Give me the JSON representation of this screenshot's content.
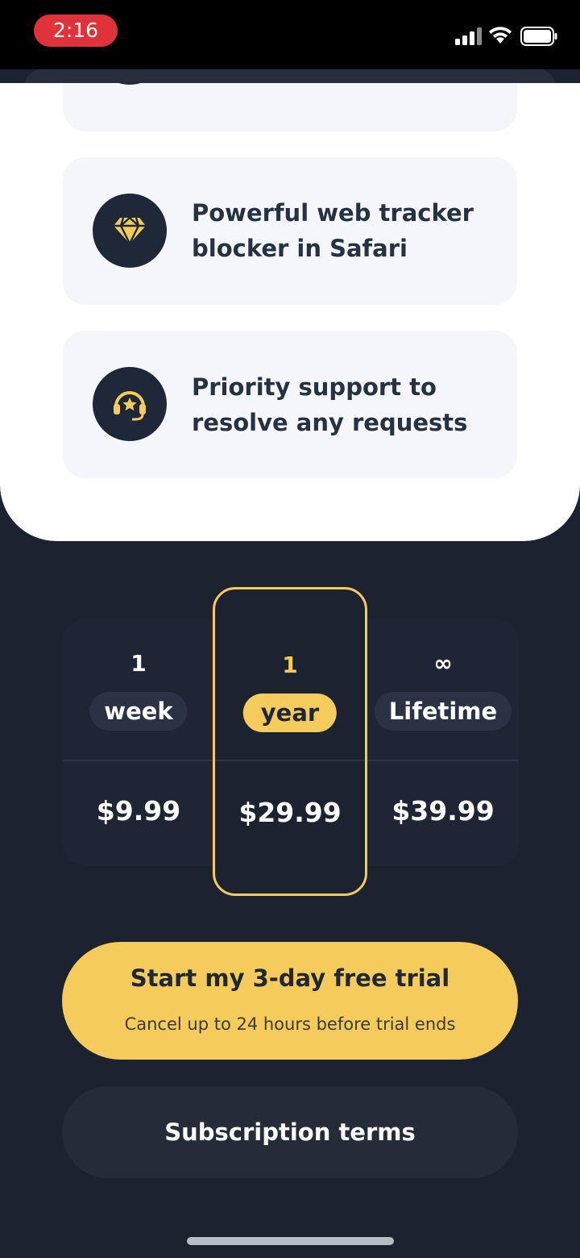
{
  "status_bar": {
    "time": "2:16"
  },
  "features": [
    {
      "icon": "generic-icon",
      "text": ""
    },
    {
      "icon": "diamond-icon",
      "text": "Powerful web tracker blocker in Safari"
    },
    {
      "icon": "headset-star-icon",
      "text": "Priority support to resolve any requests"
    }
  ],
  "plans": [
    {
      "quantity": "1",
      "unit": "week",
      "price": "$9.99",
      "selected": false
    },
    {
      "quantity": "1",
      "unit": "year",
      "price": "$29.99",
      "selected": true
    },
    {
      "quantity": "∞",
      "unit": "Lifetime",
      "price": "$39.99",
      "selected": false
    }
  ],
  "cta": {
    "title": "Start my 3-day free trial",
    "subtitle": "Cancel up to 24 hours before trial ends"
  },
  "terms_button": "Subscription terms",
  "colors": {
    "accent": "#f5cc5b",
    "background": "#1c2230",
    "card": "#f4f6fb",
    "icon_bg": "#1f2838"
  }
}
